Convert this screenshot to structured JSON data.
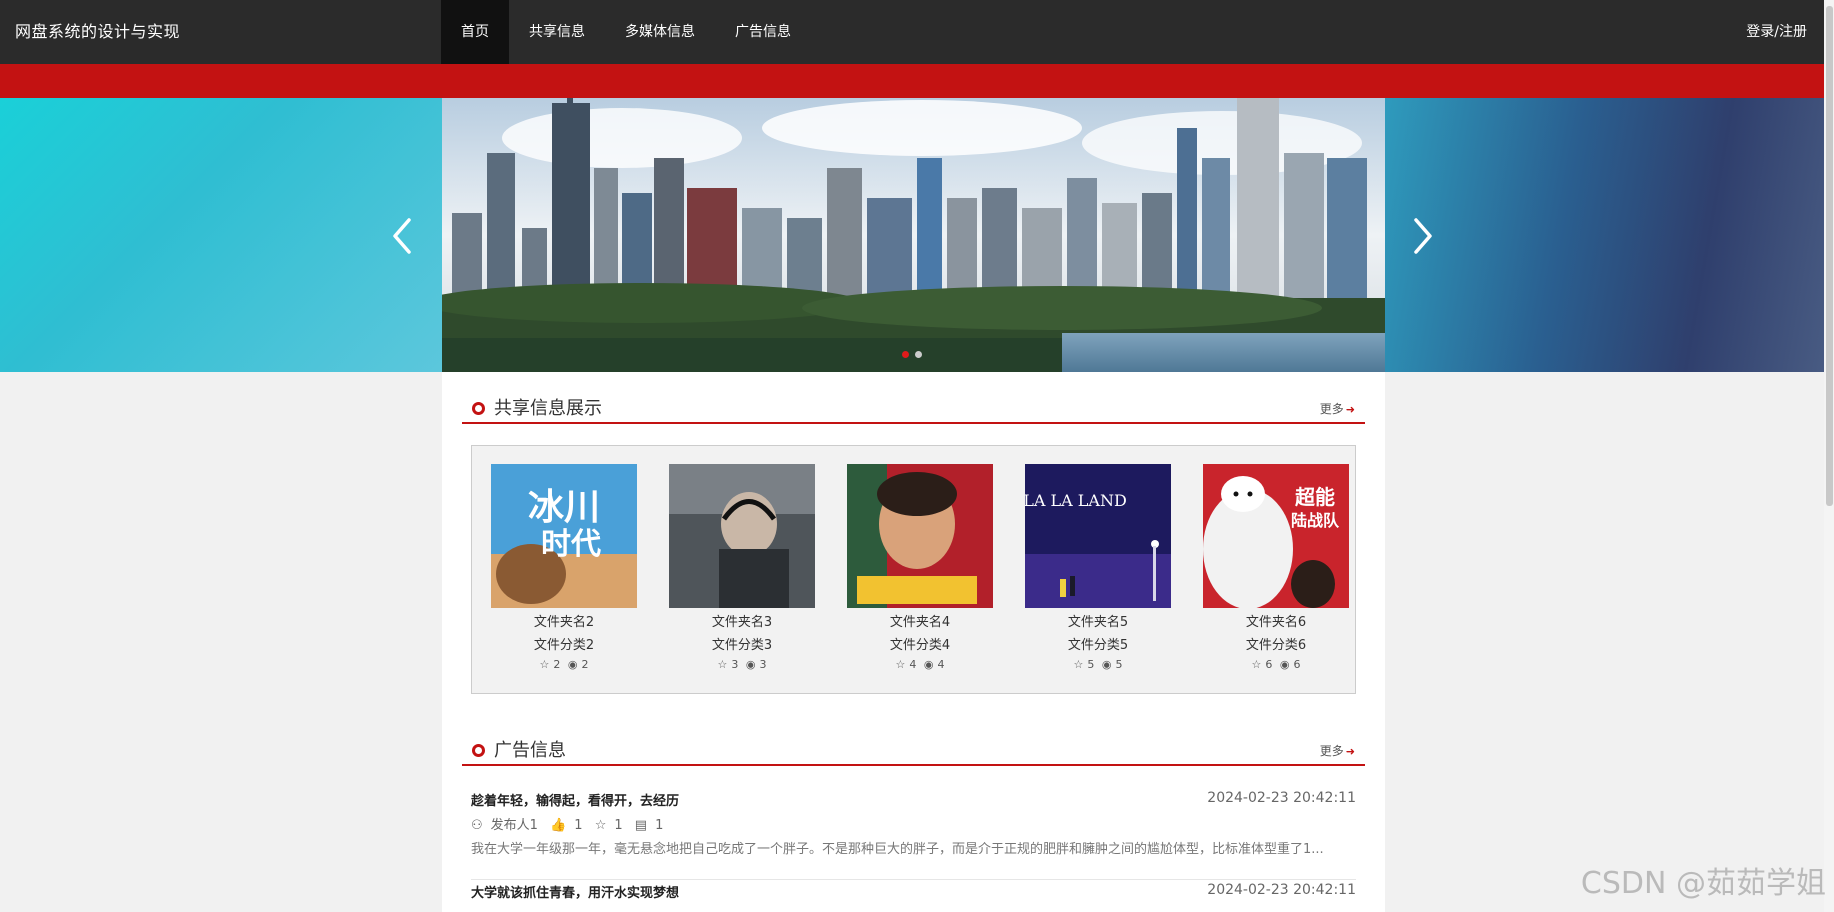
{
  "header": {
    "brand": "网盘系统的设计与实现",
    "nav": [
      "首页",
      "共享信息",
      "多媒体信息",
      "广告信息"
    ],
    "login": "登录/注册"
  },
  "colors": {
    "accent": "#c31212",
    "nav_bg": "#2b2b2b"
  },
  "banner": {
    "prev_icon": "chevron-left-icon",
    "next_icon": "chevron-right-icon",
    "active_slide": 1,
    "slides": 2
  },
  "shared": {
    "title": "共享信息展示",
    "more": "更多",
    "items": [
      {
        "name": "文件夹名2",
        "category": "文件分类2",
        "likes": "2",
        "views": "2"
      },
      {
        "name": "文件夹名3",
        "category": "文件分类3",
        "likes": "3",
        "views": "3"
      },
      {
        "name": "文件夹名4",
        "category": "文件分类4",
        "likes": "4",
        "views": "4"
      },
      {
        "name": "文件夹名5",
        "category": "文件分类5",
        "likes": "5",
        "views": "5"
      },
      {
        "name": "文件夹名6",
        "category": "文件分类6",
        "likes": "6",
        "views": "6"
      }
    ]
  },
  "ads": {
    "title": "广告信息",
    "more": "更多",
    "items": [
      {
        "title": "趁着年轻，输得起，看得开，去经历",
        "time": "2024-02-23 20:42:11",
        "author": "发布人1",
        "likes": "1",
        "favorites": "1",
        "comments": "1",
        "desc": "我在大学一年级那一年，毫无悬念地把自己吃成了一个胖子。不是那种巨大的胖子，而是介于正规的肥胖和臃肿之间的尴尬体型，比标准体型重了1..."
      },
      {
        "title": "大学就该抓住青春，用汗水实现梦想",
        "time": "2024-02-23 20:42:11"
      }
    ]
  },
  "watermark": "CSDN @茹茹学姐"
}
